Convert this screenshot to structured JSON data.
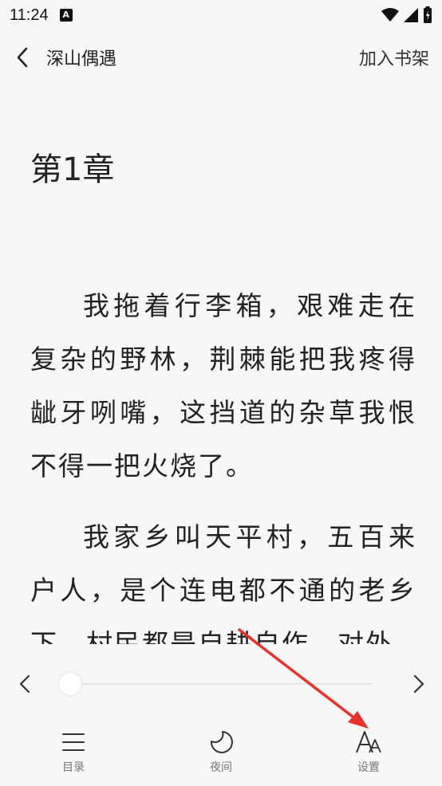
{
  "status_bar": {
    "time": "11:24",
    "notif_letter": "A"
  },
  "top_bar": {
    "title": "深山偶遇",
    "add_to_shelf": "加入书架"
  },
  "chapter": {
    "title": "第1章",
    "paragraphs": [
      "我拖着行李箱，艰难走在复杂的野林，荆棘能把我疼得龇牙咧嘴，这挡道的杂草我恨不得一把火烧了。",
      "我家乡叫天平村，五百来户人，是个连电都不通的老乡下，村民都是自耕自作，对外"
    ]
  },
  "progress": {
    "value": 0.0
  },
  "bottom_nav": {
    "items": [
      {
        "label": "目录",
        "icon": "menu-icon"
      },
      {
        "label": "夜间",
        "icon": "moon-icon"
      },
      {
        "label": "设置",
        "icon": "font-size-icon"
      }
    ]
  },
  "colors": {
    "background": "#f7f7f7",
    "annotation": "#e8322e"
  }
}
